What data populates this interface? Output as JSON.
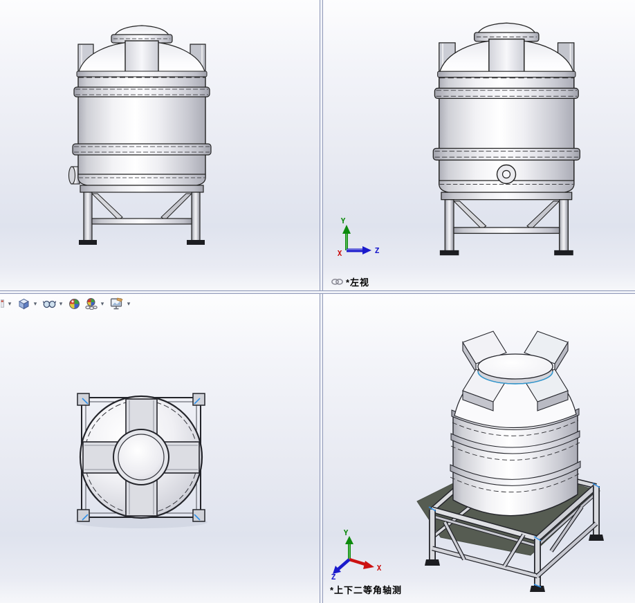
{
  "toolbar": {
    "dropdown_glyph": "▾",
    "items": [
      {
        "name": "previous-tool",
        "icon": "partial-tool-icon",
        "has_dropdown": true
      },
      {
        "name": "view-orientation",
        "icon": "view-cube-icon",
        "has_dropdown": true
      },
      {
        "name": "display-style",
        "icon": "glasses-icon",
        "has_dropdown": true
      },
      {
        "name": "edit-appearance",
        "icon": "color-ball-icon",
        "has_dropdown": false
      },
      {
        "name": "apply-scene",
        "icon": "scene-ball-chain-icon",
        "has_dropdown": true
      },
      {
        "name": "view-settings",
        "icon": "monitor-icon",
        "has_dropdown": true
      }
    ]
  },
  "viewports": {
    "top_left": {
      "view_label": ""
    },
    "top_right": {
      "view_label": "*左视",
      "link_icon": "chain-link-icon",
      "triad": {
        "x_label": "X",
        "y_label": "Y",
        "z_label": "Z"
      }
    },
    "bottom_left": {
      "view_label": ""
    },
    "bottom_right": {
      "view_label": "*上下二等角轴测",
      "triad": {
        "x_label": "X",
        "y_label": "Y",
        "z_label": "Z"
      }
    }
  },
  "colors": {
    "axis_x": "#cc1111",
    "axis_y": "#0d8a0d",
    "axis_z": "#1a1acc",
    "divider": "#8d96b6",
    "ground_shadow": "#565c52",
    "highlight_edge": "#2e9bd6"
  }
}
